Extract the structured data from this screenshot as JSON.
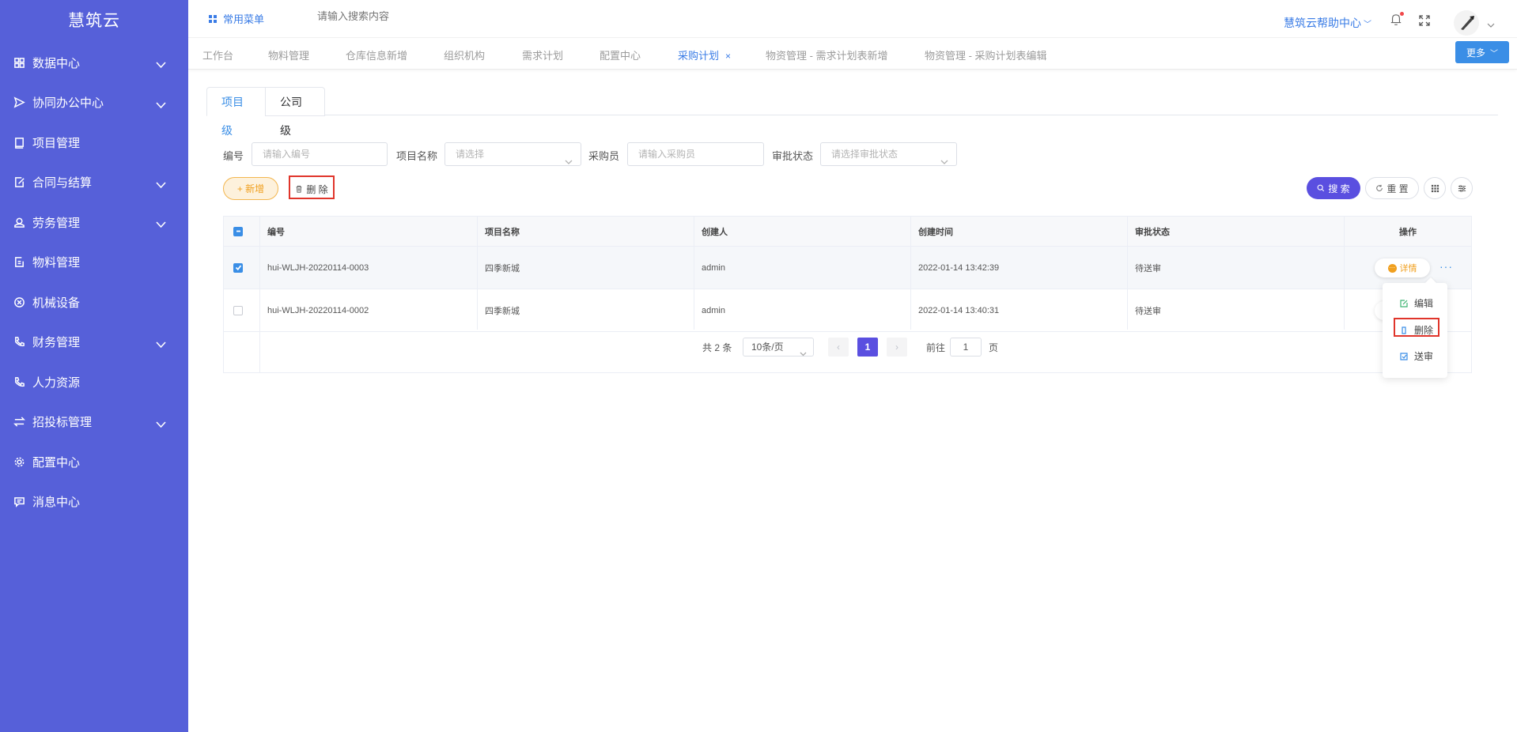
{
  "app": {
    "title": "慧筑云"
  },
  "sidebar": {
    "items": [
      {
        "label": "数据中心",
        "icon": "grid-icon",
        "expandable": true
      },
      {
        "label": "协同办公中心",
        "icon": "send-icon",
        "expandable": true
      },
      {
        "label": "项目管理",
        "icon": "book-icon",
        "expandable": false
      },
      {
        "label": "合同与结算",
        "icon": "edit-doc-icon",
        "expandable": true
      },
      {
        "label": "劳务管理",
        "icon": "worker-icon",
        "expandable": true
      },
      {
        "label": "物料管理",
        "icon": "doc-icon",
        "expandable": false
      },
      {
        "label": "机械设备",
        "icon": "close-circle-icon",
        "expandable": false
      },
      {
        "label": "财务管理",
        "icon": "phone-icon",
        "expandable": true
      },
      {
        "label": "人力资源",
        "icon": "phone-icon",
        "expandable": false
      },
      {
        "label": "招投标管理",
        "icon": "transfer-icon",
        "expandable": true
      },
      {
        "label": "配置中心",
        "icon": "gear-icon",
        "expandable": false
      },
      {
        "label": "消息中心",
        "icon": "message-icon",
        "expandable": false
      }
    ]
  },
  "header": {
    "common_menu": "常用菜单",
    "search_placeholder": "请输入搜索内容",
    "help_center": "慧筑云帮助中心"
  },
  "tabs": {
    "items": [
      {
        "label": "工作台",
        "active": false
      },
      {
        "label": "物料管理",
        "active": false
      },
      {
        "label": "仓库信息新增",
        "active": false
      },
      {
        "label": "组织机构",
        "active": false
      },
      {
        "label": "需求计划",
        "active": false
      },
      {
        "label": "配置中心",
        "active": false
      },
      {
        "label": "采购计划",
        "active": true
      },
      {
        "label": "物资管理 - 需求计划表新增",
        "active": false
      },
      {
        "label": "物资管理 - 采购计划表编辑",
        "active": false
      }
    ],
    "close": "×",
    "more": "更多"
  },
  "subtabs": {
    "project": "项目级",
    "company": "公司级"
  },
  "filters": {
    "code_label": "编号",
    "code_placeholder": "请输入编号",
    "project_label": "项目名称",
    "project_placeholder": "请选择",
    "buyer_label": "采购员",
    "buyer_placeholder": "请输入采购员",
    "status_label": "审批状态",
    "status_placeholder": "请选择审批状态"
  },
  "actions": {
    "add": "+ 新增",
    "delete": "删 除",
    "search": "搜 索",
    "reset": "重 置"
  },
  "table": {
    "columns": [
      "编号",
      "项目名称",
      "创建人",
      "创建时间",
      "审批状态",
      "操作"
    ],
    "rows": [
      {
        "code": "hui-WLJH-20220114-0003",
        "project": "四季新城",
        "creator": "admin",
        "time": "2022-01-14 13:42:39",
        "status": "待送审",
        "checked": true
      },
      {
        "code": "hui-WLJH-20220114-0002",
        "project": "四季新城",
        "creator": "admin",
        "time": "2022-01-14 13:40:31",
        "status": "待送审",
        "checked": false
      }
    ],
    "detail": "详情",
    "more": "···"
  },
  "pagination": {
    "total": "共 2 条",
    "page_size": "10条/页",
    "current": "1",
    "goto_label": "前往",
    "goto_value": "1",
    "page_suffix": "页"
  },
  "dropdown": {
    "items": [
      {
        "label": "编辑",
        "color": "#3cb371"
      },
      {
        "label": "删除",
        "color": "#3a8ee6"
      },
      {
        "label": "送审",
        "color": "#3a8ee6"
      }
    ]
  },
  "colors": {
    "sidebar": "#5660d9",
    "primary": "#3a8ee6",
    "search_btn": "#5a4fe0",
    "add_btn": "#f0a020",
    "highlight": "#e0352b"
  }
}
